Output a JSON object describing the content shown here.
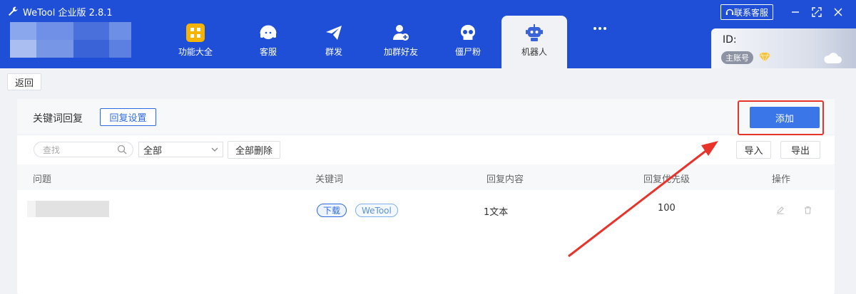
{
  "app": {
    "title": "WeTool 企业版 2.8.1",
    "accent_color": "#1f4fd6",
    "icon": "wrench-icon"
  },
  "nav": {
    "items": [
      {
        "label": "功能大全",
        "icon": "grid-apps-icon",
        "active": false
      },
      {
        "label": "客服",
        "icon": "headset-icon",
        "active": false
      },
      {
        "label": "群发",
        "icon": "paper-plane-icon",
        "active": false
      },
      {
        "label": "加群好友",
        "icon": "add-user-icon",
        "active": false
      },
      {
        "label": "僵尸粉",
        "icon": "skull-icon",
        "active": false
      },
      {
        "label": "机器人",
        "icon": "robot-icon",
        "active": true
      }
    ],
    "more_icon": "more-dots-icon"
  },
  "window": {
    "service_label": "联系客服",
    "service_icon": "headset-small-icon"
  },
  "account": {
    "id_label": "ID:",
    "role_badge": "主账号",
    "gem_icon": "diamond-icon",
    "cloud_icon": "cloud-icon"
  },
  "toolbar": {
    "back_label": "返回"
  },
  "panel": {
    "title": "关键词回复",
    "reply_settings_label": "回复设置",
    "add_label": "添加",
    "add_color": "#3b76e8"
  },
  "filters": {
    "search_placeholder": "查找",
    "select_value": "全部",
    "delete_all_label": "全部删除",
    "import_label": "导入",
    "export_label": "导出"
  },
  "table": {
    "columns": [
      "问题",
      "关键词",
      "回复内容",
      "回复优先级",
      "操作"
    ],
    "rows": [
      {
        "question": "",
        "keywords": [
          "下载",
          "WeTool"
        ],
        "reply_content": "1文本",
        "priority": "100"
      }
    ]
  },
  "annotation": {
    "highlight_color": "#e8332b"
  }
}
